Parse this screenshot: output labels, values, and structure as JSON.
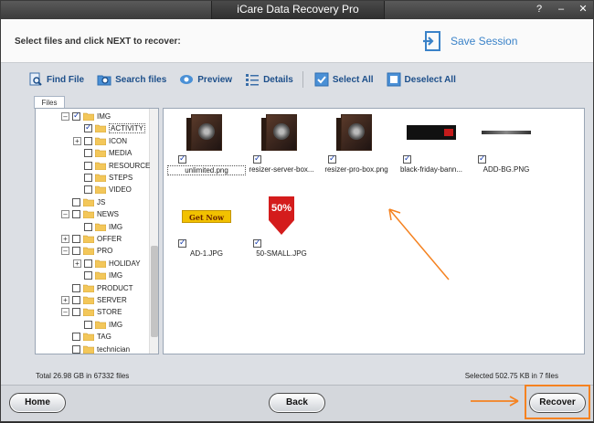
{
  "window": {
    "title": "iCare Data Recovery Pro",
    "controls": [
      "?",
      "–",
      "✕"
    ]
  },
  "header": {
    "instruction": "Select files and click NEXT to recover:",
    "save_session": "Save Session"
  },
  "toolbar": {
    "find_file": "Find File",
    "search_files": "Search files",
    "preview": "Preview",
    "details": "Details",
    "select_all": "Select All",
    "deselect_all": "Deselect All"
  },
  "files_tab": "Files",
  "tree": [
    {
      "label": "IMG",
      "indent": 0,
      "expander": "–",
      "checked": true
    },
    {
      "label": "ACTIVITY",
      "indent": 1,
      "expander": "",
      "checked": true,
      "selected": true
    },
    {
      "label": "ICON",
      "indent": 1,
      "expander": "+",
      "checked": false
    },
    {
      "label": "MEDIA",
      "indent": 1,
      "expander": "",
      "checked": false
    },
    {
      "label": "RESOURCE",
      "indent": 1,
      "expander": "",
      "checked": false
    },
    {
      "label": "STEPS",
      "indent": 1,
      "expander": "",
      "checked": false
    },
    {
      "label": "VIDEO",
      "indent": 1,
      "expander": "",
      "checked": false
    },
    {
      "label": "JS",
      "indent": 0,
      "expander": "",
      "checked": false
    },
    {
      "label": "NEWS",
      "indent": 0,
      "expander": "–",
      "checked": false
    },
    {
      "label": "IMG",
      "indent": 1,
      "expander": "",
      "checked": false
    },
    {
      "label": "OFFER",
      "indent": 0,
      "expander": "+",
      "checked": false
    },
    {
      "label": "PRO",
      "indent": 0,
      "expander": "–",
      "checked": false
    },
    {
      "label": "HOLIDAY",
      "indent": 1,
      "expander": "+",
      "checked": false
    },
    {
      "label": "IMG",
      "indent": 1,
      "expander": "",
      "checked": false
    },
    {
      "label": "PRODUCT",
      "indent": 0,
      "expander": "",
      "checked": false
    },
    {
      "label": "SERVER",
      "indent": 0,
      "expander": "+",
      "checked": false
    },
    {
      "label": "STORE",
      "indent": 0,
      "expander": "–",
      "checked": false
    },
    {
      "label": "IMG",
      "indent": 1,
      "expander": "",
      "checked": false
    },
    {
      "label": "TAG",
      "indent": 0,
      "expander": "",
      "checked": false
    },
    {
      "label": "technician",
      "indent": 0,
      "expander": "",
      "checked": false
    }
  ],
  "files": [
    {
      "name": "unlimited.png",
      "thumb": "box",
      "checked": true
    },
    {
      "name": "resizer-server-box...",
      "thumb": "box",
      "checked": true
    },
    {
      "name": "resizer-pro-box.png",
      "thumb": "box",
      "checked": true
    },
    {
      "name": "black-friday-bann...",
      "thumb": "banner",
      "checked": true
    },
    {
      "name": "ADD-BG.PNG",
      "thumb": "strip",
      "checked": true
    },
    {
      "name": "AD-1.JPG",
      "thumb": "getnow",
      "checked": true
    },
    {
      "name": "50-SMALL.JPG",
      "thumb": "tag50",
      "checked": true
    }
  ],
  "thumb_text": {
    "getnow": "Get Now",
    "tag50": "50%"
  },
  "status": {
    "total": "Total 26.98 GB in 67332 files",
    "selected": "Selected 502.75 KB in 7 files"
  },
  "footer": {
    "home": "Home",
    "back": "Back",
    "recover": "Recover"
  },
  "colors": {
    "accent": "#3a82c8",
    "annotation": "#f58220"
  }
}
